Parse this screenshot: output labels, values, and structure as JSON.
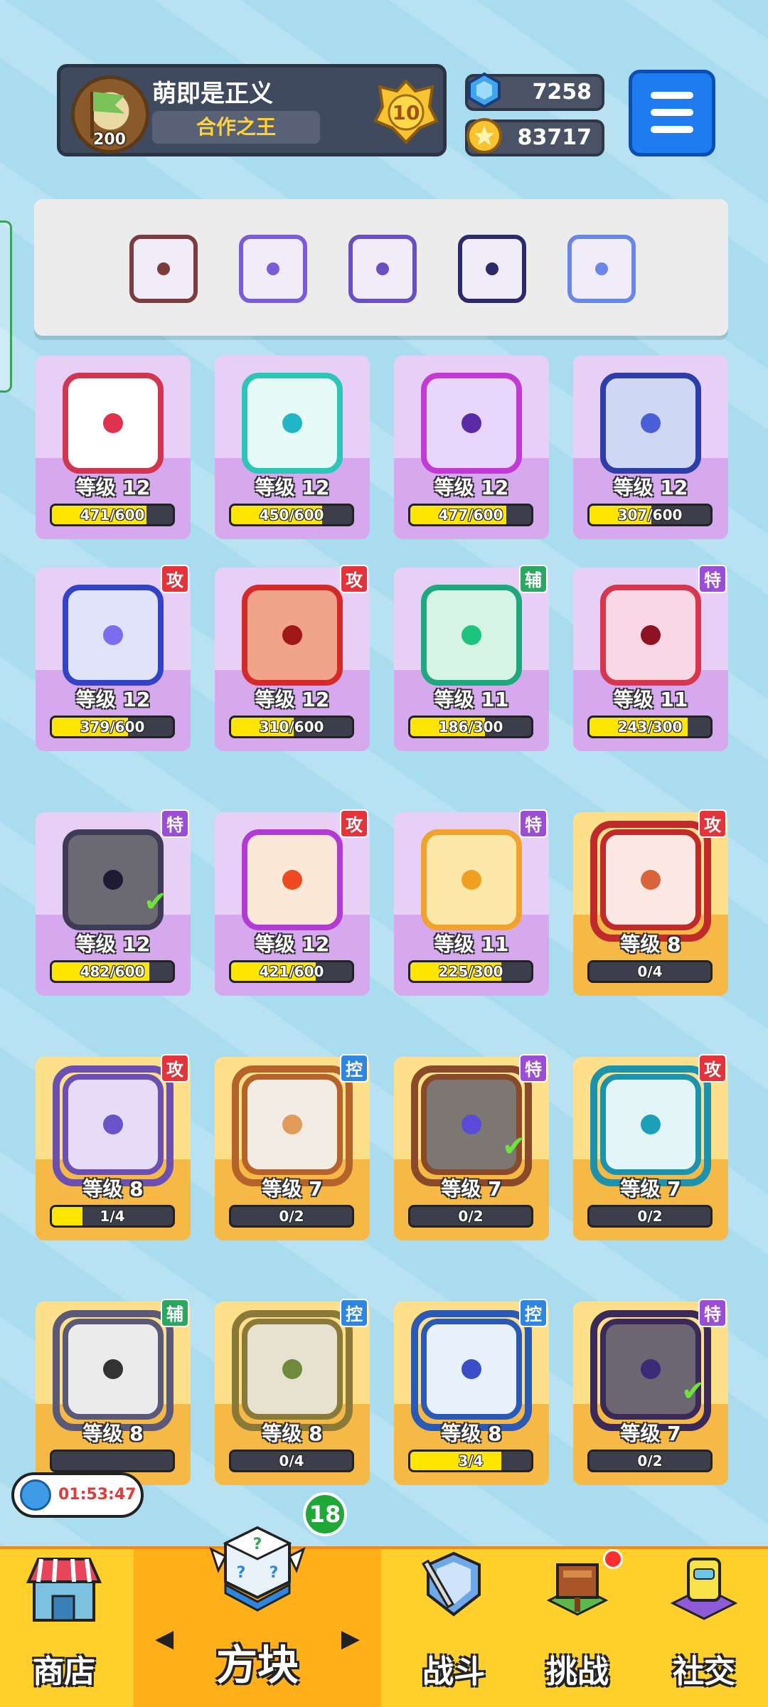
{
  "header": {
    "player_name": "萌即是正义",
    "player_title": "合作之王",
    "player_level": "200",
    "rank": "10",
    "gems": "7258",
    "coins": "83717"
  },
  "loadout": [
    {
      "name": "saw-dice",
      "color": "#7a3c3c"
    },
    {
      "name": "infinity-dice",
      "color": "#7b5bd8"
    },
    {
      "name": "purple-dice",
      "color": "#6a4fc4"
    },
    {
      "name": "dark-dot-dice",
      "color": "#2d2a6a"
    },
    {
      "name": "hands-dice",
      "color": "#6a86e6"
    }
  ],
  "cards": [
    {
      "level": "等级 12",
      "progress": "471/600",
      "fill": 0.785,
      "border": "#d2354f",
      "bg": "#ffffff",
      "pip": "#e0314e",
      "tag": "",
      "tagc": "",
      "rarity": "purple",
      "check": false,
      "legend": false
    },
    {
      "level": "等级 12",
      "progress": "450/600",
      "fill": 0.75,
      "border": "#2cc6b7",
      "bg": "#e6fbf7",
      "pip": "#22b7c4",
      "tag": "",
      "tagc": "",
      "rarity": "purple",
      "check": false,
      "legend": false
    },
    {
      "level": "等级 12",
      "progress": "477/600",
      "fill": 0.795,
      "border": "#c23ad6",
      "bg": "#e8d6fb",
      "pip": "#5a2aa8",
      "tag": "",
      "tagc": "",
      "rarity": "purple",
      "check": false,
      "legend": false
    },
    {
      "level": "等级 12",
      "progress": "307/600",
      "fill": 0.512,
      "border": "#2e3ea8",
      "bg": "#cfd8f2",
      "pip": "#4a5ed8",
      "tag": "",
      "tagc": "",
      "rarity": "purple",
      "check": false,
      "legend": false
    },
    {
      "level": "等级 12",
      "progress": "379/600",
      "fill": 0.632,
      "border": "#3343c7",
      "bg": "#dfe3fb",
      "pip": "#7c6cf0",
      "tag": "攻",
      "tagc": "#e3343c",
      "rarity": "purple",
      "check": false,
      "legend": false
    },
    {
      "level": "等级 12",
      "progress": "310/600",
      "fill": 0.517,
      "border": "#d42a2a",
      "bg": "#f2a48a",
      "pip": "#a01818",
      "tag": "攻",
      "tagc": "#e3343c",
      "rarity": "purple",
      "check": false,
      "legend": false
    },
    {
      "level": "等级 11",
      "progress": "186/300",
      "fill": 0.62,
      "border": "#1ea87e",
      "bg": "#d5f4e6",
      "pip": "#1cc47c",
      "tag": "辅",
      "tagc": "#2aa861",
      "rarity": "purple",
      "check": false,
      "legend": false
    },
    {
      "level": "等级 11",
      "progress": "243/300",
      "fill": 0.81,
      "border": "#d6364e",
      "bg": "#f7d8e4",
      "pip": "#8f1222",
      "tag": "特",
      "tagc": "#9a4ed6",
      "rarity": "purple",
      "check": false,
      "legend": false
    },
    {
      "level": "等级 12",
      "progress": "482/600",
      "fill": 0.803,
      "border": "#3f3b57",
      "bg": "#6b6a73",
      "pip": "#1d1a33",
      "tag": "特",
      "tagc": "#9a4ed6",
      "rarity": "purple",
      "check": true,
      "legend": false
    },
    {
      "level": "等级 12",
      "progress": "421/600",
      "fill": 0.702,
      "border": "#b43ad6",
      "bg": "#fbe8d6",
      "pip": "#f04a20",
      "tag": "攻",
      "tagc": "#e3343c",
      "rarity": "purple",
      "check": false,
      "legend": false
    },
    {
      "level": "等级 11",
      "progress": "225/300",
      "fill": 0.75,
      "border": "#f2a12a",
      "bg": "#fbe7a8",
      "pip": "#f0a020",
      "tag": "特",
      "tagc": "#9a4ed6",
      "rarity": "purple",
      "check": false,
      "legend": false
    },
    {
      "level": "等级 8",
      "progress": "0/4",
      "fill": 0,
      "border": "#c12a2a",
      "bg": "#fbe8e2",
      "pip": "#d9643a",
      "tag": "攻",
      "tagc": "#e3343c",
      "rarity": "orange",
      "check": false,
      "legend": true
    },
    {
      "level": "等级 8",
      "progress": "1/4",
      "fill": 0.25,
      "border": "#6c4fb2",
      "bg": "#e6dcf7",
      "pip": "#6a52c8",
      "tag": "攻",
      "tagc": "#e3343c",
      "rarity": "orange",
      "check": false,
      "legend": true
    },
    {
      "level": "等级 7",
      "progress": "0/2",
      "fill": 0,
      "border": "#b5632a",
      "bg": "#f3ece4",
      "pip": "#e09a5a",
      "tag": "控",
      "tagc": "#2f86e0",
      "rarity": "orange",
      "check": false,
      "legend": true
    },
    {
      "level": "等级 7",
      "progress": "0/2",
      "fill": 0,
      "border": "#8a4a2a",
      "bg": "#7d7774",
      "pip": "#5a4ad8",
      "tag": "特",
      "tagc": "#9a4ed6",
      "rarity": "orange",
      "check": true,
      "legend": true
    },
    {
      "level": "等级 7",
      "progress": "0/2",
      "fill": 0,
      "border": "#1c93ae",
      "bg": "#e4f5f8",
      "pip": "#1ca0ba",
      "tag": "攻",
      "tagc": "#e3343c",
      "rarity": "orange",
      "check": false,
      "legend": true
    },
    {
      "level": "等级 8",
      "progress": "",
      "fill": 0,
      "border": "#5a5a78",
      "bg": "#ebebeb",
      "pip": "#333333",
      "tag": "辅",
      "tagc": "#2aa861",
      "rarity": "orange",
      "check": false,
      "legend": true
    },
    {
      "level": "等级 8",
      "progress": "0/4",
      "fill": 0,
      "border": "#8a7a3a",
      "bg": "#e6e2cf",
      "pip": "#6e8a3a",
      "tag": "控",
      "tagc": "#2f86e0",
      "rarity": "orange",
      "check": false,
      "legend": true
    },
    {
      "level": "等级 8",
      "progress": "3/4",
      "fill": 0.75,
      "border": "#2a5ab8",
      "bg": "#e8f1fb",
      "pip": "#3a4ec8",
      "tag": "控",
      "tagc": "#2f86e0",
      "rarity": "orange",
      "check": false,
      "legend": true
    },
    {
      "level": "等级 7",
      "progress": "0/2",
      "fill": 0,
      "border": "#3a2a5a",
      "bg": "#6b6672",
      "pip": "#3a2a78",
      "tag": "特",
      "tagc": "#9a4ed6",
      "rarity": "orange",
      "check": true,
      "legend": true
    }
  ],
  "timer": "01:53:47",
  "new_count": "18",
  "nav": {
    "shop": "商店",
    "dice": "方块",
    "battle": "战斗",
    "challenge": "挑战",
    "social": "社交"
  }
}
